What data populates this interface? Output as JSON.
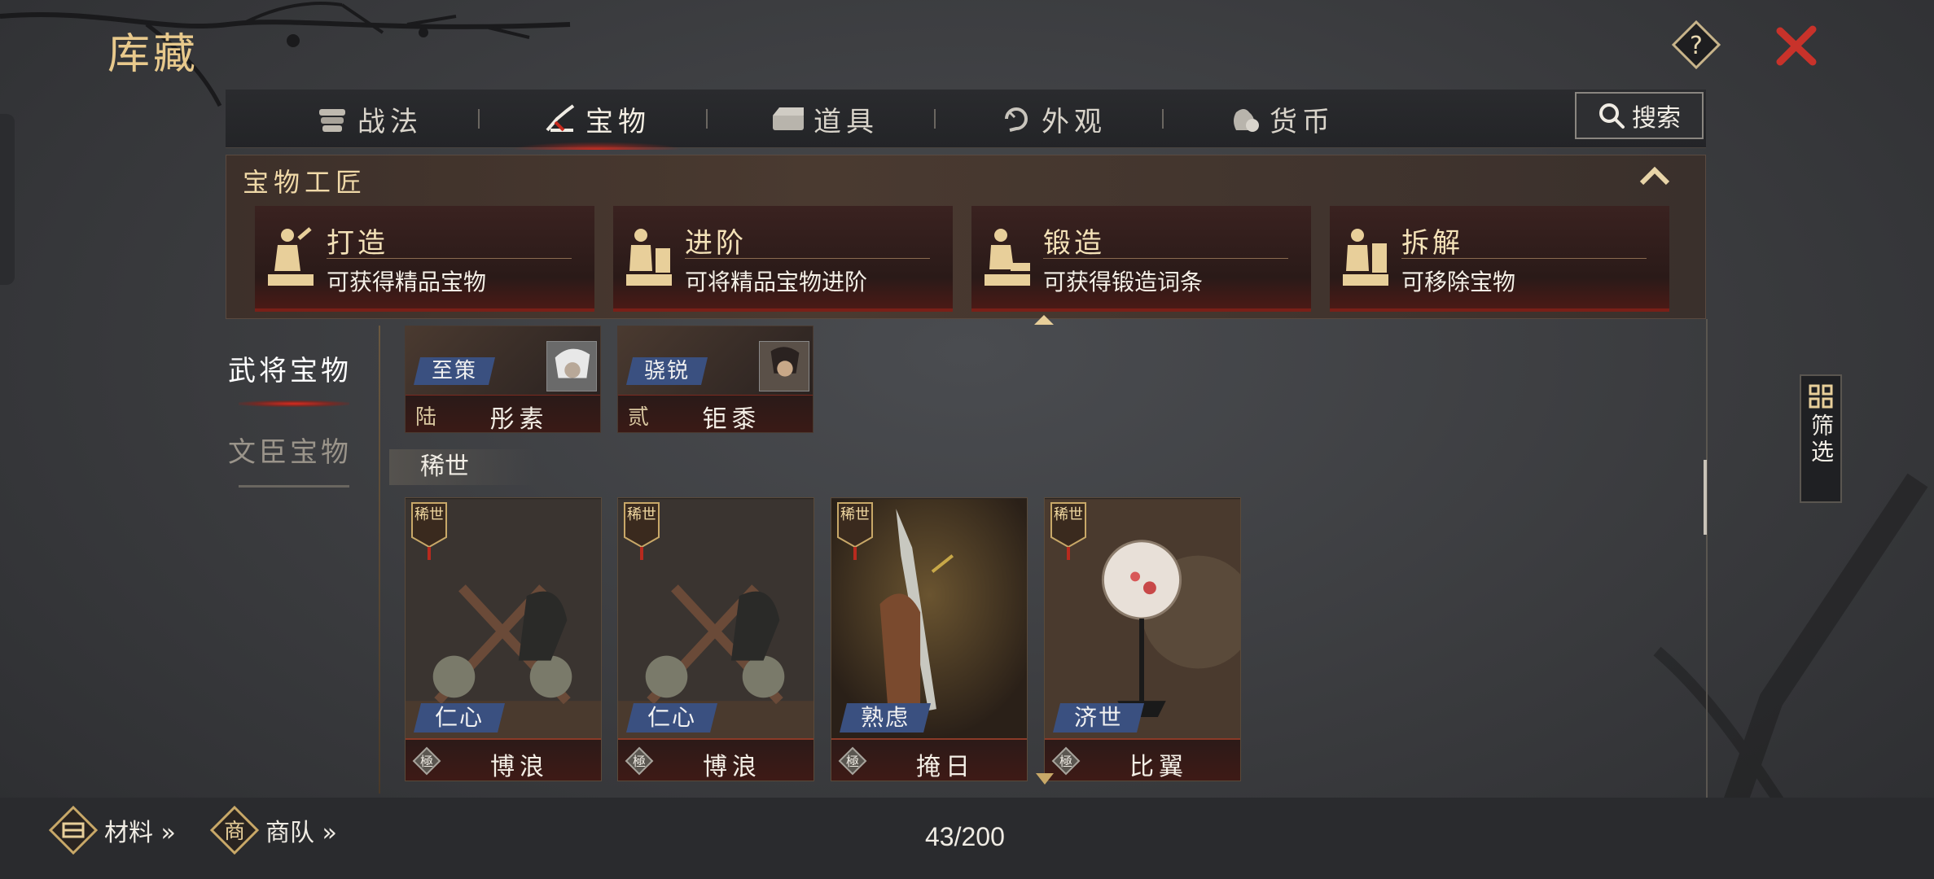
{
  "header": {
    "title": "库藏"
  },
  "tabs": [
    {
      "label": "战法",
      "icon": "scrolls-icon"
    },
    {
      "label": "宝物",
      "icon": "treasure-icon",
      "active": true
    },
    {
      "label": "道具",
      "icon": "chest-icon"
    },
    {
      "label": "外观",
      "icon": "appearance-icon"
    },
    {
      "label": "货币",
      "icon": "coin-bag-icon"
    }
  ],
  "search": {
    "label": "搜索"
  },
  "craft": {
    "title": "宝物工匠",
    "cards": [
      {
        "name": "打造",
        "desc": "可获得精品宝物"
      },
      {
        "name": "进阶",
        "desc": "可将精品宝物进阶"
      },
      {
        "name": "锻造",
        "desc": "可获得锻造词条"
      },
      {
        "name": "拆解",
        "desc": "可移除宝物"
      }
    ]
  },
  "categories": {
    "general": "武将宝物",
    "civil": "文臣宝物"
  },
  "filter": {
    "label": "筛选"
  },
  "top_cards": [
    {
      "tag": "至策",
      "grade": "陆",
      "name": "彤素"
    },
    {
      "tag": "骁锐",
      "grade": "贰",
      "name": "钜黍"
    }
  ],
  "section": {
    "label": "稀世"
  },
  "treasures": [
    {
      "rarity": "稀世",
      "tag": "仁心",
      "badge": "極",
      "name": "博浪"
    },
    {
      "rarity": "稀世",
      "tag": "仁心",
      "badge": "極",
      "name": "博浪"
    },
    {
      "rarity": "稀世",
      "tag": "熟虑",
      "badge": "極",
      "name": "掩日"
    },
    {
      "rarity": "稀世",
      "tag": "济世",
      "badge": "極",
      "name": "比翼"
    }
  ],
  "bottom": {
    "materials": "材料 »",
    "materials_icon": "商",
    "caravan": "商队 »",
    "caravan_icon": "商",
    "counter": "43/200"
  },
  "colors": {
    "accent_red": "#c92a1f",
    "gold": "#e8c98c",
    "tag_blue": "#3a5080"
  }
}
